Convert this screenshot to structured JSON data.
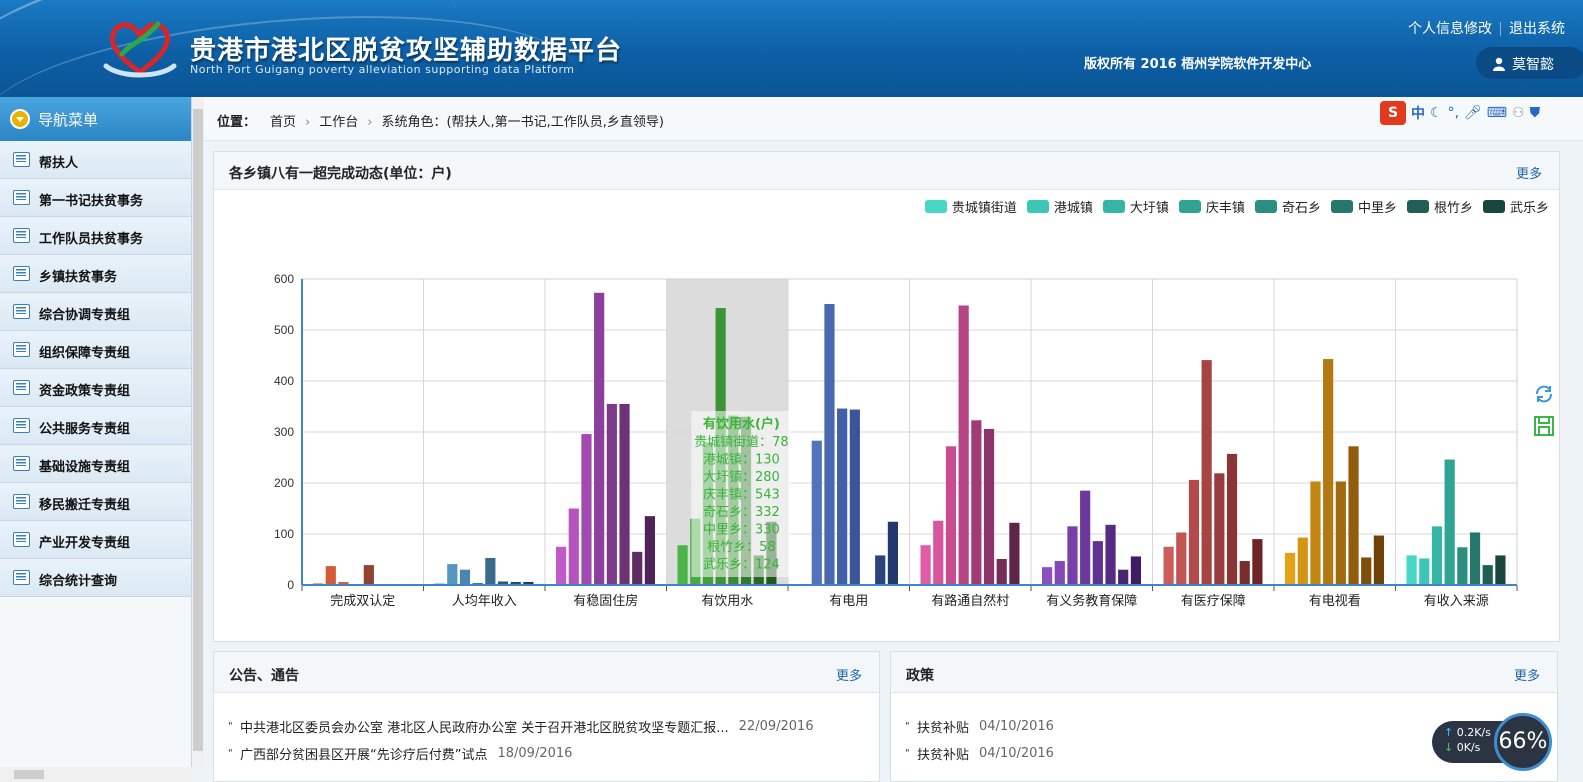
{
  "header": {
    "title": "贵港市港北区脱贫攻坚辅助数据平台",
    "subtitle": "North Port Guigang poverty alleviation supporting data Platform",
    "copyright": "版权所有 2016 梧州学院软件开发中心",
    "link_profile": "个人信息修改",
    "link_logout": "退出系统",
    "username": "莫智懿"
  },
  "sidebar": {
    "title": "导航菜单",
    "items": [
      {
        "label": "帮扶人"
      },
      {
        "label": "第一书记扶贫事务"
      },
      {
        "label": "工作队员扶贫事务"
      },
      {
        "label": "乡镇扶贫事务"
      },
      {
        "label": "综合协调专责组"
      },
      {
        "label": "组织保障专责组"
      },
      {
        "label": "资金政策专责组"
      },
      {
        "label": "公共服务专责组"
      },
      {
        "label": "基础设施专责组"
      },
      {
        "label": "移民搬迁专责组"
      },
      {
        "label": "产业开发专责组"
      },
      {
        "label": "综合统计查询"
      }
    ]
  },
  "breadcrumb": {
    "label": "位置：",
    "home": "首页",
    "workbench": "工作台",
    "role": "系统角色：(帮扶人,第一书记,工作队员,乡直领导)"
  },
  "ime": {
    "logo": "S",
    "mode": "中"
  },
  "chart_panel": {
    "title": "各乡镇八有一超完成动态(单位：户)",
    "more": "更多"
  },
  "chart_data": {
    "type": "bar",
    "title": "各乡镇八有一超完成动态(单位：户)",
    "categories": [
      "完成双认定",
      "人均年收入",
      "有稳固住房",
      "有饮用水",
      "有电用",
      "有路通自然村",
      "有义务教育保障",
      "有医疗保障",
      "有电视看",
      "有收入来源"
    ],
    "ylim": [
      0,
      600
    ],
    "yticks": [
      0,
      100,
      200,
      300,
      400,
      500,
      600
    ],
    "legend_position": "top-right",
    "grid": true,
    "legend_colors": [
      "#47d7c7",
      "#3cc6b6",
      "#35b5a5",
      "#2fa493",
      "#2a8f80",
      "#26786d",
      "#1f5f56",
      "#19463f"
    ],
    "series": [
      {
        "name": "贵城镇街道",
        "values": [
          3,
          3,
          75,
          78,
          0,
          78,
          35,
          75,
          63,
          58
        ]
      },
      {
        "name": "港城镇",
        "values": [
          37,
          41,
          150,
          130,
          283,
          126,
          47,
          103,
          93,
          52
        ]
      },
      {
        "name": "大圩镇",
        "values": [
          6,
          30,
          296,
          280,
          551,
          272,
          115,
          206,
          203,
          115
        ]
      },
      {
        "name": "庆丰镇",
        "values": [
          0,
          4,
          573,
          543,
          346,
          548,
          185,
          441,
          443,
          246
        ]
      },
      {
        "name": "奇石乡",
        "values": [
          39,
          53,
          355,
          332,
          344,
          323,
          86,
          219,
          203,
          74
        ]
      },
      {
        "name": "中里乡",
        "values": [
          0,
          7,
          355,
          330,
          0,
          306,
          118,
          257,
          272,
          103
        ]
      },
      {
        "name": "根竹乡",
        "values": [
          2,
          6,
          65,
          58,
          58,
          51,
          30,
          47,
          54,
          39
        ]
      },
      {
        "name": "武乐乡",
        "values": [
          2,
          6,
          135,
          124,
          124,
          122,
          56,
          90,
          97,
          58
        ]
      }
    ],
    "category_colors": [
      [
        "#d9532f",
        "#d45a35",
        "#cf6139",
        "#c9573a",
        "#8f4330",
        "#7a3a2a",
        "#6a2e22",
        "#5a261c"
      ],
      [
        "#5ea7d2",
        "#5596c0",
        "#4c86ae",
        "#44789c",
        "#3b6a8a",
        "#335b78",
        "#2a4d66",
        "#223f54"
      ],
      [
        "#c05ac9",
        "#b653bf",
        "#a24ab0",
        "#8c3f9c",
        "#7d3a8c",
        "#6e3277",
        "#5f2a66",
        "#50225a"
      ],
      [
        "#4cb548",
        "#47ab42",
        "#42a03c",
        "#3c9436",
        "#378a31",
        "#2f7a2b",
        "#286a24",
        "#205a1e"
      ],
      [
        "#5a7cc7",
        "#5373bc",
        "#4a68b1",
        "#4260a8",
        "#3a569b",
        "#334c8c",
        "#2b427d",
        "#23386e"
      ],
      [
        "#e05ca6",
        "#d6559c",
        "#c84c90",
        "#b74485",
        "#a03b77",
        "#8c3369",
        "#772b5a",
        "#62234b"
      ],
      [
        "#8c4fc2",
        "#8248b6",
        "#773fa9",
        "#6c389b",
        "#613190",
        "#562a82",
        "#4b2373",
        "#401c64"
      ],
      [
        "#cf5c5c",
        "#c25454",
        "#b44b4b",
        "#a64343",
        "#983b3b",
        "#8a3434",
        "#7c2c2c",
        "#6e2424"
      ],
      [
        "#e5a216",
        "#d49414",
        "#c38612",
        "#b37810",
        "#a26a0e",
        "#915c0c",
        "#804e0a",
        "#6f4008"
      ],
      [
        "#47d7c7",
        "#3cc6b6",
        "#35b5a5",
        "#2fa493",
        "#2a8f80",
        "#26786d",
        "#1f5f56",
        "#19463f"
      ]
    ],
    "tooltip": {
      "category": "有饮用水",
      "title": "有饮用水(户)",
      "lines": [
        "贵城镇街道：78",
        "港城镇：130",
        "大圩镇：280",
        "庆丰镇：543",
        "奇石乡：332",
        "中里乡：330",
        "根竹乡：58",
        "武乐乡：124"
      ]
    }
  },
  "notices": {
    "title": "公告、通告",
    "more": "更多",
    "items": [
      {
        "text": "中共港北区委员会办公室 港北区人民政府办公室 关于召开港北区脱贫攻坚专题汇报...",
        "date": "22/09/2016"
      },
      {
        "text": "广西部分贫困县区开展“先诊疗后付费”试点",
        "date": "18/09/2016"
      }
    ]
  },
  "policy": {
    "title": "政策",
    "more": "更多",
    "items": [
      {
        "text": "扶贫补贴",
        "date": "04/10/2016"
      },
      {
        "text": "扶贫补贴",
        "date": "04/10/2016"
      }
    ]
  },
  "speed_widget": {
    "up": "0.2K/s",
    "down": "0K/s",
    "percent": "66%"
  }
}
